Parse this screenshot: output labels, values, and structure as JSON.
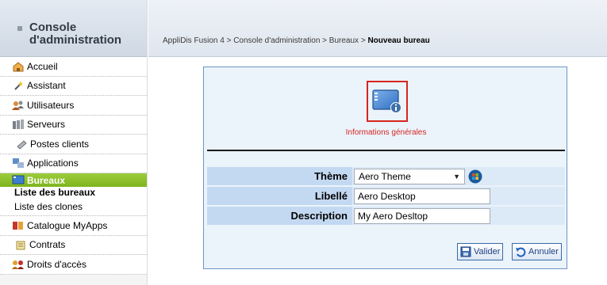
{
  "sidebar": {
    "title": "Console d'administration",
    "items": [
      {
        "label": "Accueil",
        "icon": "home-icon"
      },
      {
        "label": "Assistant",
        "icon": "wand-icon"
      },
      {
        "label": "Utilisateurs",
        "icon": "users-icon"
      },
      {
        "label": "Serveurs",
        "icon": "servers-icon"
      },
      {
        "label": "Postes clients",
        "icon": "client-workstation-icon"
      },
      {
        "label": "Applications",
        "icon": "applications-icon"
      },
      {
        "label": "Bureaux",
        "icon": "desktop-icon",
        "active": true
      },
      {
        "label": "Catalogue MyApps",
        "icon": "catalog-icon"
      },
      {
        "label": "Contrats",
        "icon": "contract-icon"
      },
      {
        "label": "Droits d'accès",
        "icon": "access-rights-icon"
      }
    ],
    "sub_items": [
      {
        "label": "Liste des bureaux"
      },
      {
        "label": "Liste des clones"
      }
    ]
  },
  "breadcrumb": {
    "path": "AppliDis Fusion 4 > Console d'administration > Bureaux > ",
    "current": "Nouveau bureau"
  },
  "panel": {
    "section_label": "Informations générales",
    "fields": {
      "theme_label": "Thème",
      "theme_value": "Aero Theme",
      "libelle_label": "Libellé",
      "libelle_value": "Aero Desktop",
      "description_label": "Description",
      "description_value": "My Aero Desltop"
    },
    "buttons": {
      "valider": "Valider",
      "annuler": "Annuler"
    }
  },
  "colors": {
    "accent_green": "#8cc12c",
    "panel_border": "#6a96c7",
    "label_red": "#d6261f"
  }
}
